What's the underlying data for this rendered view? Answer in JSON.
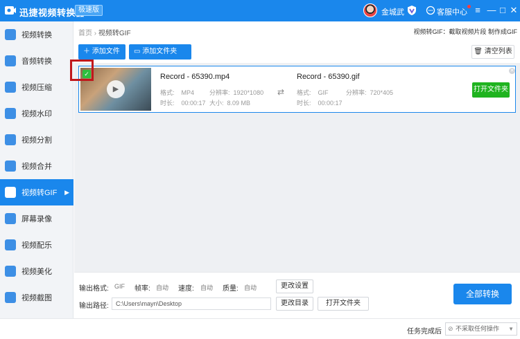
{
  "titlebar": {
    "app_title": "迅捷视频转换器",
    "badge": "极速版",
    "username": "金城武",
    "service": "客服中心",
    "menu_icon": "≡",
    "min_icon": "—",
    "max_icon": "□",
    "close_icon": "✕"
  },
  "sidebar": {
    "items": [
      {
        "label": "视频转换"
      },
      {
        "label": "音频转换"
      },
      {
        "label": "视频压缩"
      },
      {
        "label": "视频水印"
      },
      {
        "label": "视频分割"
      },
      {
        "label": "视频合并"
      },
      {
        "label": "视频转GIF",
        "active": true
      },
      {
        "label": "屏幕录像"
      },
      {
        "label": "视频配乐"
      },
      {
        "label": "视频美化"
      },
      {
        "label": "视频截图"
      }
    ]
  },
  "breadcrumb": {
    "home": "首页",
    "sep": "›",
    "current": "视频转GIF"
  },
  "tagline": "视频转GIF：截取视频片段 制作成GIF",
  "toolbar": {
    "add_file": "添加文件",
    "add_folder": "添加文件夹",
    "clear_list": "清空列表"
  },
  "file": {
    "source_name": "Record - 65390.mp4",
    "target_name": "Record - 65390.gif",
    "format_label": "格式:",
    "source_format": "MP4",
    "target_format": "GIF",
    "resolution_label": "分辨率:",
    "source_resolution": "1920*1080",
    "target_resolution": "720*405",
    "duration_label": "时长:",
    "source_duration": "00:00:17",
    "target_duration": "00:00:17",
    "size_label": "大小:",
    "source_size": "8.09 MB",
    "open_folder": "打开文件夹"
  },
  "settings": {
    "output_format_label": "输出格式:",
    "output_format": "GIF",
    "fps_label": "帧率:",
    "fps": "自动",
    "speed_label": "速度:",
    "speed": "自动",
    "quality_label": "质量:",
    "quality": "自动",
    "change_settings": "更改设置",
    "output_path_label": "输出路径:",
    "output_path": "C:\\Users\\mayn\\Desktop",
    "change_dir": "更改目录",
    "open_folder": "打开文件夹",
    "convert_all": "全部转换"
  },
  "statusbar": {
    "after_task_label": "任务完成后",
    "after_task_value": "不采取任何操作"
  },
  "colors": {
    "accent": "#1a87ec",
    "success": "#1fb31f",
    "highlight": "#c0181c"
  }
}
